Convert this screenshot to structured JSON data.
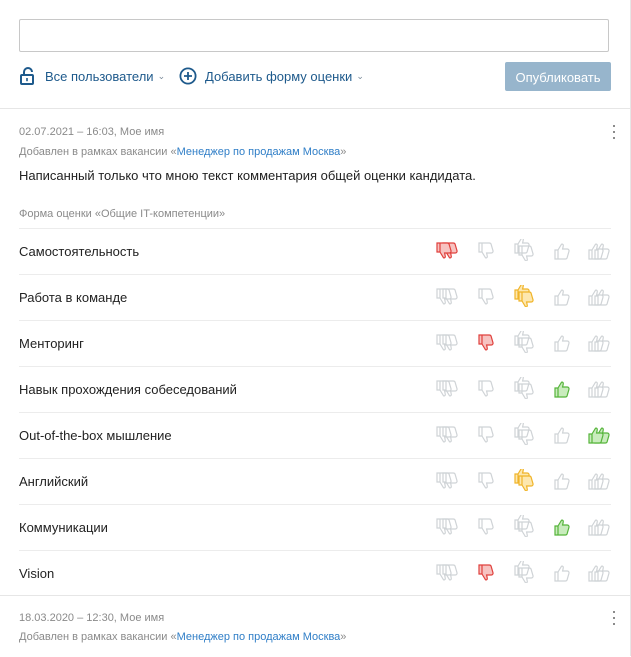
{
  "toolbar": {
    "visibility_label": "Все пользователи",
    "add_form_label": "Добавить форму оценки",
    "publish_label": "Опубликовать"
  },
  "entries": [
    {
      "meta_date": "02.07.2021 – 16:03, Мое имя",
      "meta_context_prefix": "Добавлен в рамках вакансии «",
      "meta_context_link": "Менеджер по продажам Москва",
      "meta_context_suffix": "»",
      "text": "Написанный только что мною текст комментария общей оценки кандидата.",
      "form_title": "Форма оценки «Общие IT-компетенции»",
      "rows": [
        {
          "label": "Самостоятельность",
          "rating": 1
        },
        {
          "label": "Работа в команде",
          "rating": 3
        },
        {
          "label": "Менторинг",
          "rating": 2
        },
        {
          "label": "Навык прохождения собеседований",
          "rating": 4
        },
        {
          "label": "Out-of-the-box мышление",
          "rating": 5
        },
        {
          "label": "Английский",
          "rating": 3
        },
        {
          "label": "Коммуникации",
          "rating": 4
        },
        {
          "label": "Vision",
          "rating": 2
        }
      ]
    },
    {
      "meta_date": "18.03.2020 – 12:30, Мое имя",
      "meta_context_prefix": "Добавлен в рамках вакансии «",
      "meta_context_link": "Менеджер по продажам Москва",
      "meta_context_suffix": "»"
    }
  ],
  "rating_scale": [
    "strongly-negative",
    "negative",
    "neutral",
    "positive",
    "strongly-positive"
  ],
  "rating_icons": [
    "double-thumbs-down-icon",
    "thumb-down-icon",
    "thumbs-sideways-icon",
    "thumb-up-icon",
    "double-thumbs-up-icon"
  ],
  "colors": {
    "accent": "#1e5a8c",
    "link": "#2f7ec7",
    "publish_disabled": "#97b5cc",
    "inactive_icon": "#cfd3d6",
    "rating_1": "#e0413d",
    "rating_2": "#e0413d",
    "rating_3": "#f0b429",
    "rating_4": "#56b53b",
    "rating_5": "#56b53b"
  }
}
